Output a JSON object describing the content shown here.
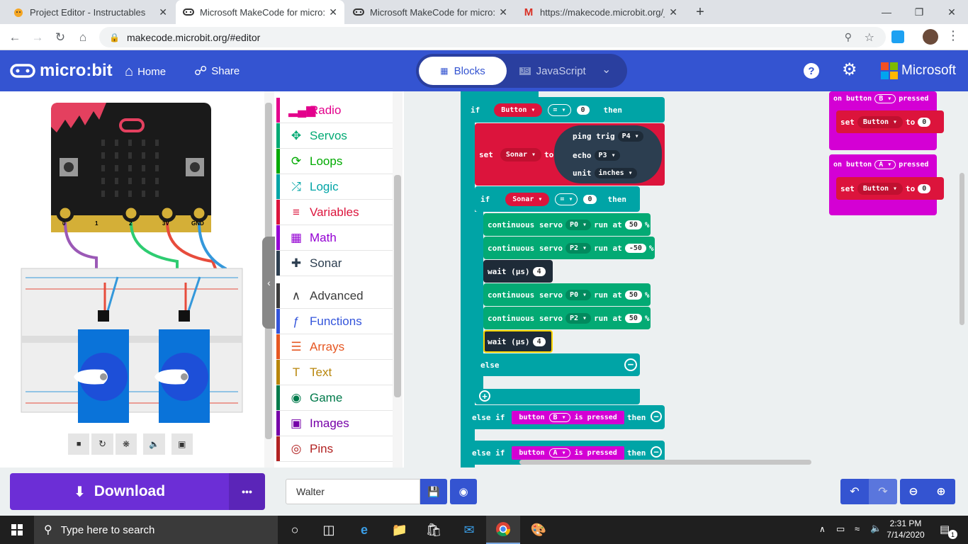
{
  "browser": {
    "tabs": [
      {
        "title": "Project Editor - Instructables",
        "icon": "instructables-icon",
        "close": "✕"
      },
      {
        "title": "Microsoft MakeCode for micro:bi",
        "icon": "makecode-icon",
        "close": "✕"
      },
      {
        "title": "Microsoft MakeCode for micro:bi",
        "icon": "makecode-icon",
        "close": "✕"
      },
      {
        "title": "https://makecode.microbit.org/_l",
        "icon": "gmail-icon",
        "close": "✕"
      }
    ],
    "new_tab": "+",
    "url": "makecode.microbit.org/#editor"
  },
  "header": {
    "logo": "micro:bit",
    "home": "Home",
    "share": "Share",
    "blocks_tab": "Blocks",
    "js_tab": "JavaScript",
    "brand": "Microsoft"
  },
  "simulator": {
    "pins": [
      "0",
      "1",
      "2",
      "3V",
      "GND"
    ]
  },
  "toolbox": {
    "categories": [
      {
        "label": "Radio",
        "color": "#e3008c",
        "icon": "▂▄▆"
      },
      {
        "label": "Servos",
        "color": "#03aa74",
        "icon": "✥"
      },
      {
        "label": "Loops",
        "color": "#00aa00",
        "icon": "⟳"
      },
      {
        "label": "Logic",
        "color": "#00a4a6",
        "icon": "⤮"
      },
      {
        "label": "Variables",
        "color": "#dc143c",
        "icon": "≡"
      },
      {
        "label": "Math",
        "color": "#9400d3",
        "icon": "▦"
      },
      {
        "label": "Sonar",
        "color": "#2c3e50",
        "icon": "✚"
      },
      {
        "label": "Advanced",
        "color": "#3c3c3c",
        "icon": "∧"
      },
      {
        "label": "Functions",
        "color": "#3455db",
        "icon": "ƒ"
      },
      {
        "label": "Arrays",
        "color": "#e65722",
        "icon": "☰"
      },
      {
        "label": "Text",
        "color": "#b8860b",
        "icon": "T"
      },
      {
        "label": "Game",
        "color": "#007a4b",
        "icon": "◉"
      },
      {
        "label": "Images",
        "color": "#7600a8",
        "icon": "▣"
      },
      {
        "label": "Pins",
        "color": "#b22222",
        "icon": "◎"
      }
    ]
  },
  "blocks": {
    "if1": {
      "kw": "if",
      "var": "Button",
      "op": "=",
      "val": "0",
      "then": "then"
    },
    "set_sonar": {
      "kw": "set",
      "var": "Sonar",
      "to": "to",
      "ping": "ping trig",
      "ping_pin": "P4",
      "echo": "echo",
      "echo_pin": "P3",
      "unit": "unit",
      "unit_val": "inches"
    },
    "if2": {
      "kw": "if",
      "var": "Sonar",
      "op": "=",
      "val": "0",
      "then": "then"
    },
    "servo1": {
      "text": "continuous servo",
      "pin": "P0",
      "run": "run at",
      "val": "50",
      "pct": "%"
    },
    "servo2": {
      "text": "continuous servo",
      "pin": "P2",
      "run": "run at",
      "val": "-50",
      "pct": "%"
    },
    "wait1": {
      "text": "wait (µs)",
      "val": "4"
    },
    "servo3": {
      "text": "continuous servo",
      "pin": "P0",
      "run": "run at",
      "val": "50",
      "pct": "%"
    },
    "servo4": {
      "text": "continuous servo",
      "pin": "P2",
      "run": "run at",
      "val": "50",
      "pct": "%"
    },
    "wait2": {
      "text": "wait (µs)",
      "val": "4"
    },
    "else": "else",
    "elseif1": {
      "kw": "else if",
      "btn": "button",
      "btn_val": "B",
      "pressed": "is pressed",
      "then": "then"
    },
    "elseif2": {
      "kw": "else if",
      "btn": "button",
      "btn_val": "A",
      "pressed": "is pressed",
      "then": "then"
    },
    "onB": {
      "kw": "on button",
      "btn": "B",
      "pressed": "pressed",
      "set": "set",
      "var": "Button",
      "to": "to",
      "val": "0"
    },
    "onA": {
      "kw": "on button",
      "btn": "A",
      "pressed": "pressed",
      "set": "set",
      "var": "Button",
      "to": "to",
      "val": "0"
    }
  },
  "bottom": {
    "download": "Download",
    "more": "•••",
    "project_name": "Walter"
  },
  "taskbar": {
    "search_placeholder": "Type here to search",
    "time": "2:31 PM",
    "date": "7/14/2020",
    "notif_count": "1"
  }
}
